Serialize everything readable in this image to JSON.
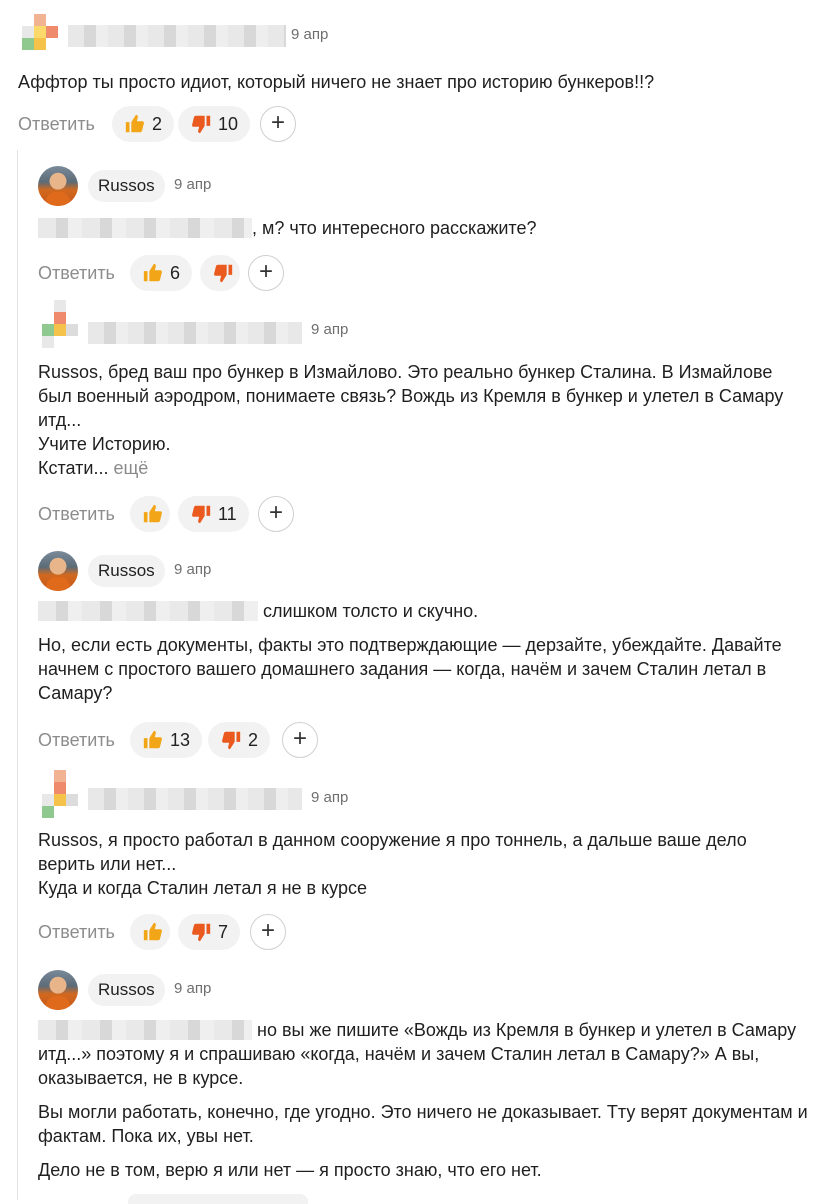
{
  "ui": {
    "reply_label": "Ответить",
    "more_label": "ещё"
  },
  "comments": [
    {
      "date": "9 апр",
      "paragraphs": [
        "Аффтор ты просто идиот, который ничего не знает про историю бункеров!!?"
      ],
      "likes": "2",
      "dislikes": "10"
    },
    {
      "author": "Russos",
      "date": "9 апр",
      "paragraphs": [
        ", м? что интересного расскажите?"
      ],
      "likes": "6",
      "dislikes": ""
    },
    {
      "date": "9 апр",
      "paragraphs": [
        "Russos, бред ваш про бункер в Измайлово. Это реально бункер Сталина. В Измайлове был военный аэродром, понимаете связь? Вождь из Кремля в бункер и улетел в Самару итд...",
        "Учите Историю.",
        "Кстати..."
      ],
      "likes": "",
      "dislikes": "11"
    },
    {
      "author": "Russos",
      "date": "9 апр",
      "paragraphs": [
        "слишком толсто и скучно.",
        "Но, если есть документы, факты это подтверждающие — дерзайте, убеждайте. Давайте начнем с простого вашего домашнего задания — когда, начём и зачем Сталин летал в Самару?"
      ],
      "likes": "13",
      "dislikes": "2"
    },
    {
      "date": "9 апр",
      "paragraphs": [
        "Russos, я просто работал в данном сооружение я про тоннель, а дальше ваше дело верить или нет...",
        "Куда и когда Сталин летал я не в курсе"
      ],
      "likes": "",
      "dislikes": "7"
    },
    {
      "author": "Russos",
      "date": "9 апр",
      "paragraphs": [
        "но вы же пишите «Вождь из Кремля в бункер и улетел в Самару итд...» поэтому я и спрашиваю «когда, начём и зачем Сталин летал в Самару?» А вы, оказывается, не в курсе.",
        "Вы могли работать, конечно, где угодно. Это ничего не доказывает. Тту верят документам и фактам. Пока их, увы нет.",
        "Дело не в том, верю я или нет — я просто знаю, что его нет."
      ]
    }
  ],
  "colors": {
    "like": "#f2a516",
    "dislike": "#ea5a1e",
    "chip": "#f2f2f2",
    "muted": "#8c8c8c"
  },
  "icons": {
    "like": "thumbs-up-icon",
    "dislike": "thumbs-down-icon",
    "add": "add-reaction-icon"
  },
  "add_glyph": "+"
}
